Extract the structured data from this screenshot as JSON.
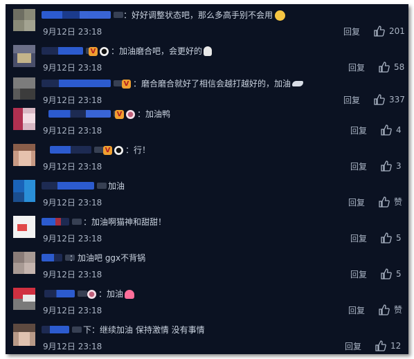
{
  "comments": [
    {
      "text": "：好好调整状态吧，那么多高手别不会用",
      "time": "9月12日 23:18",
      "reply": "回复",
      "likes": "201"
    },
    {
      "text": "：加油磨合吧，会更好的",
      "time": "9月12日 23:18",
      "reply": "回复",
      "likes": "58"
    },
    {
      "text": "：磨合磨合就好了相信会越打越好的，加油",
      "time": "9月12日 23:18",
      "reply": "回复",
      "likes": "337"
    },
    {
      "text": "：加油鸭",
      "time": "9月12日 23:18",
      "reply": "回复",
      "likes": "4"
    },
    {
      "text": "：行！",
      "time": "9月12日 23:18",
      "reply": "回复",
      "likes": "3"
    },
    {
      "text": "加油",
      "time": "9月12日 23:18",
      "reply": "回复",
      "likes": "赞"
    },
    {
      "text": "：加油啊猫神和甜甜！",
      "time": "9月12日 23:18",
      "reply": "回复",
      "likes": "5"
    },
    {
      "text": "：加油吧 ggx不背锅",
      "time": "9月12日 23:18",
      "reply": "回复",
      "likes": "5"
    },
    {
      "text": "：加油",
      "time": "9月12日 23:18",
      "reply": "回复",
      "likes": "赞"
    },
    {
      "text": "下：继续加油 保持激情 没有事情",
      "time": "9月12日 23:18",
      "reply": "回复",
      "likes": "12"
    }
  ],
  "icons": {
    "like": "thumbs-up-icon"
  },
  "colors": {
    "background": "#0b1222",
    "text": "#c9d2df",
    "meta": "#aab4c4"
  }
}
